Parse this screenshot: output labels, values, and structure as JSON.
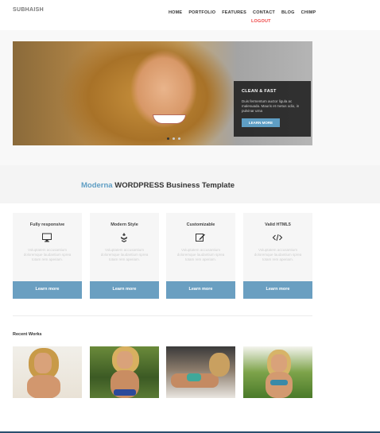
{
  "header": {
    "logo": "SUBHAISH",
    "nav": [
      "HOME",
      "PORTFOLIO",
      "FEATURES",
      "CONTACT",
      "BLOG",
      "CHIMP"
    ],
    "logout": "LOGOUT"
  },
  "slider": {
    "caption_title": "CLEAN & FAST",
    "caption_text": "Duis fermentum auctor ligula ac malesuada. Mauris et metus odio, in pulvinar urna",
    "caption_button": "LEARN MORE",
    "dots": 3,
    "active_dot": 1
  },
  "tagline": {
    "accent": "Moderna",
    "rest": " WORDPRESS Business Template"
  },
  "features": [
    {
      "title": "Fully responsive",
      "icon": "monitor-icon",
      "desc": "Voluptatem accusantium doloremque laudantium sprea totam rem aperiam.",
      "button": "Learn more"
    },
    {
      "title": "Modern Style",
      "icon": "leaf-icon",
      "desc": "Voluptatem accusantium doloremque laudantium sprea totam rem aperiam.",
      "button": "Learn more"
    },
    {
      "title": "Customizable",
      "icon": "edit-icon",
      "desc": "Voluptatem accusantium doloremque laudantium sprea totam rem aperiam.",
      "button": "Learn more"
    },
    {
      "title": "Valid HTML5",
      "icon": "code-icon",
      "desc": "Voluptatem accusantium doloremque laudantium sprea totam rem aperiam.",
      "button": "Learn more"
    }
  ],
  "recent_works": {
    "title": "Recent Works",
    "items": [
      "work-1",
      "work-2",
      "work-3",
      "work-4"
    ]
  },
  "colors": {
    "accent": "#5f9ec4",
    "button": "#6a9fc1",
    "logout": "#e44444",
    "caption_bg": "#1e1e1e"
  }
}
